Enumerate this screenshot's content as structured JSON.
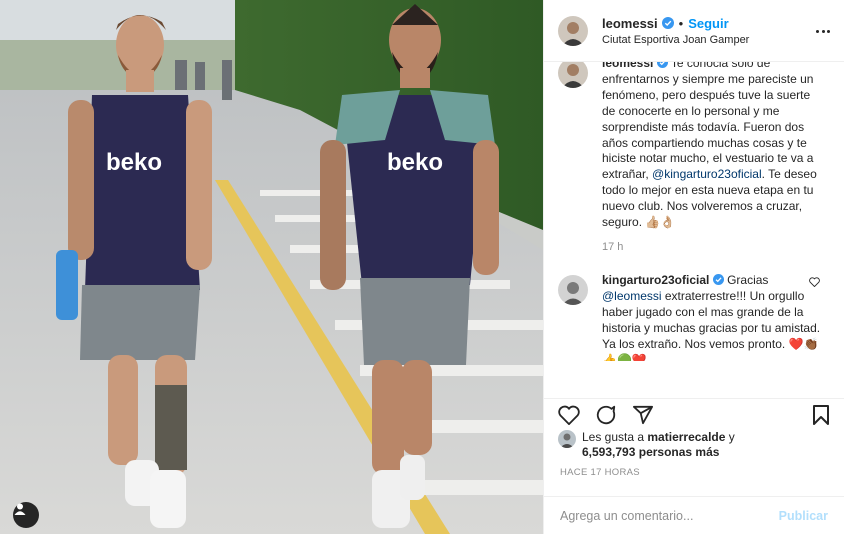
{
  "header": {
    "username": "leomessi",
    "follow_label": "Seguir",
    "separator": "•",
    "location": "Ciutat Esportiva Joan Gamper",
    "more_icon": "more-horizontal-icon"
  },
  "caption": {
    "username": "leomessi",
    "text_before_mention": "Te conocia sólo de enfrentarnos y siempre me pareciste un fenómeno, pero después tuve la suerte de conocerte en lo personal y me sorprendiste más todavía. Fueron dos años compartiendo muchas cosas y te hiciste notar mucho, el vestuario te va a extrañar,",
    "mention": "@kingarturo23oficial",
    "text_after_mention": ". Te deseo todo lo mejor en esta nueva etapa en tu nuevo club. Nos volveremos a cruzar, seguro.",
    "emoji": "👍🏼👌🏼",
    "time_ago": "17 h"
  },
  "reply": {
    "username": "kingarturo23oficial",
    "text_before_mention": "Gracias",
    "mention": "@leomessi",
    "text_after_mention": "extraterrestre!!! Un orgullo haber jugado con el mas grande de la historia y muchas gracias por tu amistad. Ya los extraño. Nos vemos pronto.",
    "emoji": "❤️👏🏾",
    "extra_emoji": "👍🟢❤️"
  },
  "photo": {
    "jersey_text_left": "beko",
    "jersey_text_right": "beko"
  },
  "likes": {
    "prefix": "Les gusta a",
    "user": "matierrecalde",
    "conj": "y",
    "count": "6,593,793",
    "suffix": "personas más"
  },
  "timestamp": "HACE 17 HORAS",
  "add_comment": {
    "placeholder": "Agrega un comentario...",
    "publish_label": "Publicar"
  },
  "colors": {
    "accent": "#0095f6",
    "publish_disabled": "#b2dffc",
    "heart_red": "#ed4956"
  }
}
